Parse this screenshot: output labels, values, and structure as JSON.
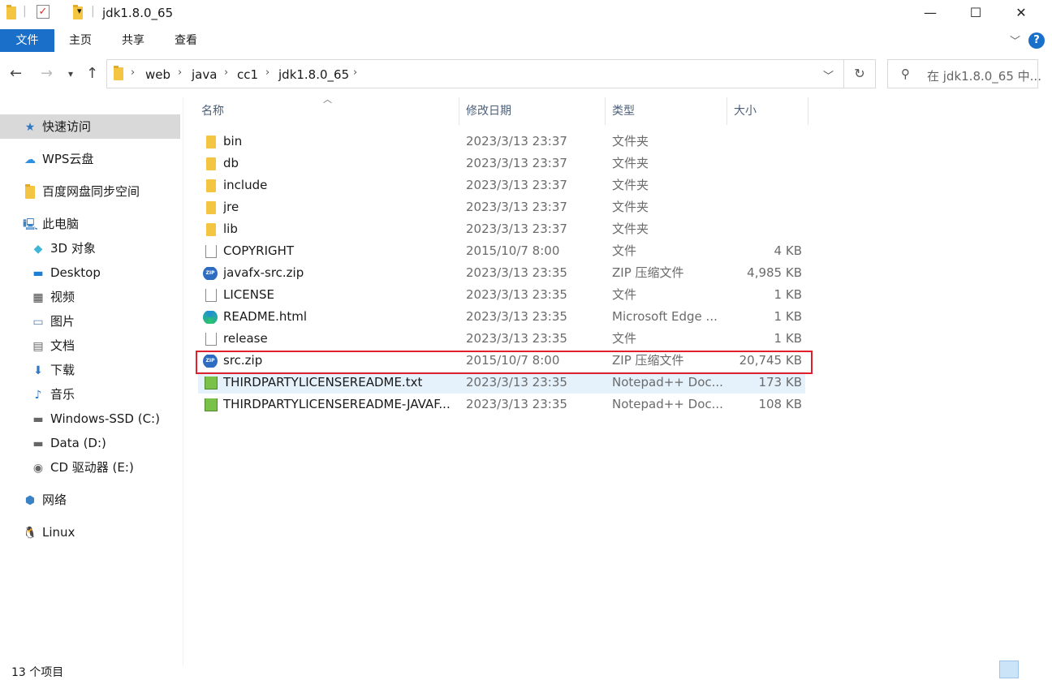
{
  "window": {
    "title": "jdk1.8.0_65",
    "minimize": "—",
    "maximize": "☐",
    "close": "✕"
  },
  "ribbon": {
    "tabs": [
      "文件",
      "主页",
      "共享",
      "查看"
    ],
    "help": "?"
  },
  "address": {
    "breadcrumbs": [
      "web",
      "java",
      "cc1",
      "jdk1.8.0_65"
    ],
    "search_placeholder": "在 jdk1.8.0_65 中..."
  },
  "sidebar": {
    "items": [
      {
        "label": "快速访问",
        "icon": "star-icon"
      },
      {
        "label": "WPS云盘",
        "icon": "cloud-icon"
      },
      {
        "label": "百度网盘同步空间",
        "icon": "folder-icon"
      },
      {
        "label": "此电脑",
        "icon": "computer-icon"
      },
      {
        "label": "3D 对象",
        "icon": "cube-icon"
      },
      {
        "label": "Desktop",
        "icon": "desktop-icon"
      },
      {
        "label": "视频",
        "icon": "video-icon"
      },
      {
        "label": "图片",
        "icon": "picture-icon"
      },
      {
        "label": "文档",
        "icon": "document-icon"
      },
      {
        "label": "下载",
        "icon": "download-icon"
      },
      {
        "label": "音乐",
        "icon": "music-icon"
      },
      {
        "label": "Windows-SSD (C:)",
        "icon": "drive-icon"
      },
      {
        "label": "Data (D:)",
        "icon": "drive-icon"
      },
      {
        "label": "CD 驱动器 (E:)",
        "icon": "cd-drive-icon"
      },
      {
        "label": "网络",
        "icon": "network-icon"
      },
      {
        "label": "Linux",
        "icon": "linux-icon"
      }
    ]
  },
  "columns": {
    "name": "名称",
    "date": "修改日期",
    "type": "类型",
    "size": "大小"
  },
  "files": [
    {
      "name": "bin",
      "date": "2023/3/13 23:37",
      "type": "文件夹",
      "size": "",
      "icon": "folder"
    },
    {
      "name": "db",
      "date": "2023/3/13 23:37",
      "type": "文件夹",
      "size": "",
      "icon": "folder"
    },
    {
      "name": "include",
      "date": "2023/3/13 23:37",
      "type": "文件夹",
      "size": "",
      "icon": "folder"
    },
    {
      "name": "jre",
      "date": "2023/3/13 23:37",
      "type": "文件夹",
      "size": "",
      "icon": "folder"
    },
    {
      "name": "lib",
      "date": "2023/3/13 23:37",
      "type": "文件夹",
      "size": "",
      "icon": "folder"
    },
    {
      "name": "COPYRIGHT",
      "date": "2015/10/7 8:00",
      "type": "文件",
      "size": "4 KB",
      "icon": "doc"
    },
    {
      "name": "javafx-src.zip",
      "date": "2023/3/13 23:35",
      "type": "ZIP 压缩文件",
      "size": "4,985 KB",
      "icon": "zip"
    },
    {
      "name": "LICENSE",
      "date": "2023/3/13 23:35",
      "type": "文件",
      "size": "1 KB",
      "icon": "doc"
    },
    {
      "name": "README.html",
      "date": "2023/3/13 23:35",
      "type": "Microsoft Edge ...",
      "size": "1 KB",
      "icon": "edge"
    },
    {
      "name": "release",
      "date": "2023/3/13 23:35",
      "type": "文件",
      "size": "1 KB",
      "icon": "doc"
    },
    {
      "name": "src.zip",
      "date": "2015/10/7 8:00",
      "type": "ZIP 压缩文件",
      "size": "20,745 KB",
      "icon": "zip"
    },
    {
      "name": "THIRDPARTYLICENSEREADME.txt",
      "date": "2023/3/13 23:35",
      "type": "Notepad++ Doc...",
      "size": "173 KB",
      "icon": "npp"
    },
    {
      "name": "THIRDPARTYLICENSEREADME-JAVAF...",
      "date": "2023/3/13 23:35",
      "type": "Notepad++ Doc...",
      "size": "108 KB",
      "icon": "npp"
    }
  ],
  "status": {
    "count": "13 个项目"
  }
}
